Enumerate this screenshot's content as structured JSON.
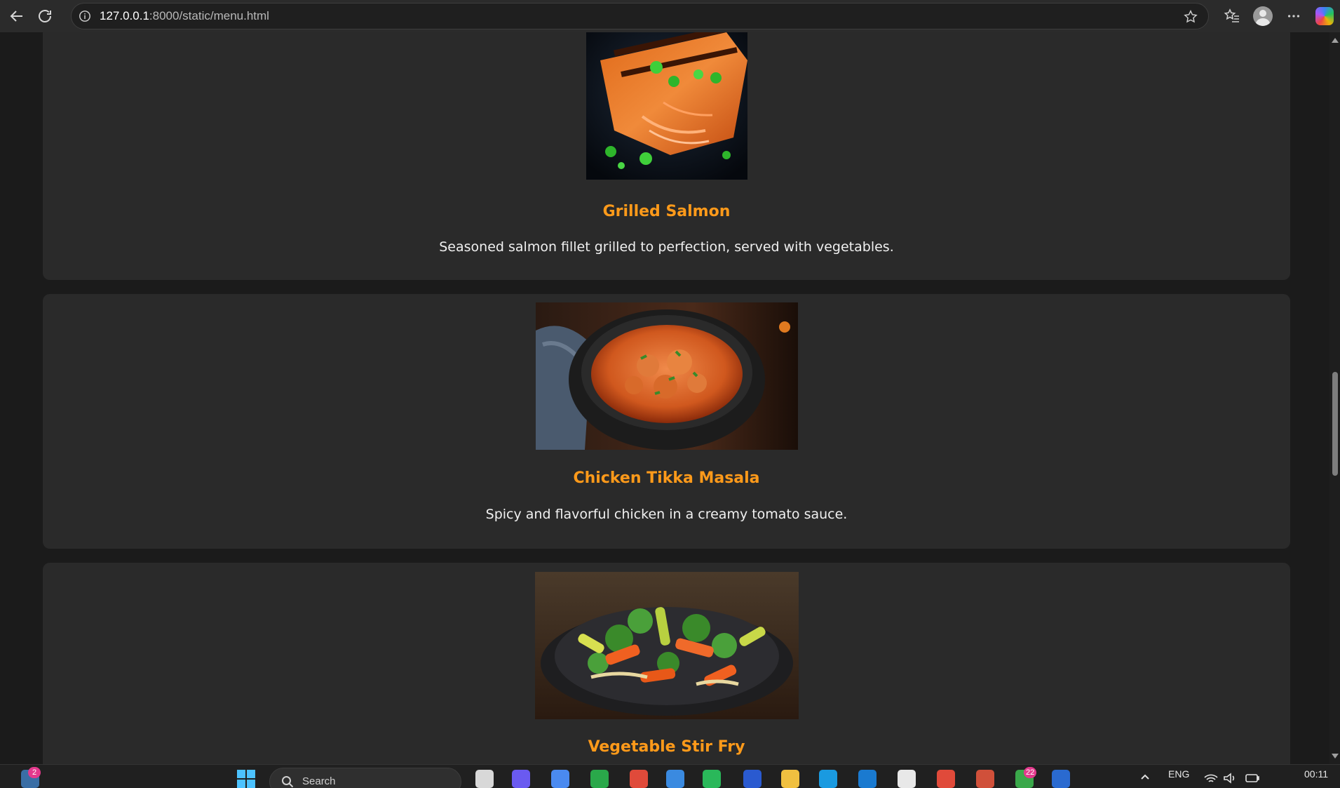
{
  "browser": {
    "url_host": "127.0.0.1",
    "url_path": ":8000/static/menu.html"
  },
  "menu": {
    "items": [
      {
        "name": "Grilled Salmon",
        "description": "Seasoned salmon fillet grilled to perfection, served with vegetables."
      },
      {
        "name": "Chicken Tikka Masala",
        "description": "Spicy and flavorful chicken in a creamy tomato sauce."
      },
      {
        "name": "Vegetable Stir Fry",
        "description": ""
      }
    ]
  },
  "taskbar": {
    "notification_count": "2",
    "search_placeholder": "Search",
    "app_badge_count": "22",
    "language": "ENG",
    "time": "00:11"
  },
  "colors": {
    "accent": "#ff9a1a",
    "card_bg": "#2a2a2a",
    "page_bg": "#1b1b1b"
  }
}
